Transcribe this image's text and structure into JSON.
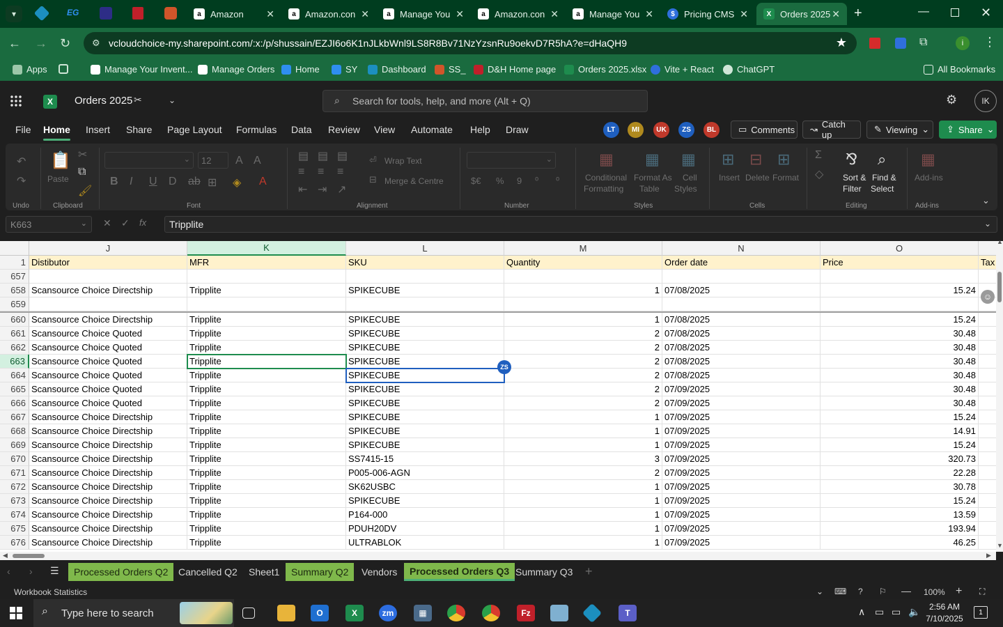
{
  "browser": {
    "tabs": [
      {
        "label": "Amazon",
        "icon": "amazon-icon"
      },
      {
        "label": "Amazon.con",
        "icon": "amazon-icon"
      },
      {
        "label": "Manage You",
        "icon": "amazon-icon"
      },
      {
        "label": "Amazon.con",
        "icon": "amazon-icon"
      },
      {
        "label": "Manage You",
        "icon": "amazon-icon"
      },
      {
        "label": "Pricing CMS",
        "icon": "dollar-icon"
      },
      {
        "label": "Orders 2025",
        "icon": "excel-icon"
      }
    ],
    "url": "vcloudchoice-my.sharepoint.com/:x:/p/shussain/EZJI6o6K1nJLkbWnl9LS8R8Bv71NzYzsnRu9oekvD7R5hA?e=dHaQH9",
    "bookmarks": [
      "Apps",
      "Manage Your Invent...",
      "Manage Orders",
      "Home",
      "SY",
      "Dashboard",
      "SS_",
      "D&H Home page",
      "Orders 2025.xlsx",
      "Vite + React",
      "ChatGPT"
    ],
    "all_bookmarks": "All Bookmarks"
  },
  "excel": {
    "title": "Orders 2025",
    "search_placeholder": "Search for tools, help, and more (Alt + Q)",
    "user_initials": "IK",
    "menu": [
      "File",
      "Home",
      "Insert",
      "Share",
      "Page Layout",
      "Formulas",
      "Data",
      "Review",
      "View",
      "Automate",
      "Help",
      "Draw"
    ],
    "active_menu": "Home",
    "collaborators": [
      {
        "initials": "LT",
        "color": "#1f5fbf"
      },
      {
        "initials": "MI",
        "color": "#b08a1e"
      },
      {
        "initials": "UK",
        "color": "#c0392b"
      },
      {
        "initials": "ZS",
        "color": "#1f5fbf"
      },
      {
        "initials": "BL",
        "color": "#c0392b"
      }
    ],
    "buttons": {
      "comments": "Comments",
      "catch_up": "Catch up",
      "viewing": "Viewing",
      "share": "Share"
    },
    "ribbon": {
      "undo_group": "Undo",
      "clipboard_group": "Clipboard",
      "paste": "Paste",
      "font_group": "Font",
      "font_size": "12",
      "alignment_group": "Alignment",
      "wrap_text": "Wrap Text",
      "merge_centre": "Merge & Centre",
      "number_group": "Number",
      "styles_group": "Styles",
      "conditional_1": "Conditional",
      "conditional_2": "Formatting",
      "format_as_1": "Format As",
      "format_as_2": "Table",
      "cell_styles_1": "Cell",
      "cell_styles_2": "Styles",
      "cells_group": "Cells",
      "insert": "Insert",
      "delete": "Delete",
      "format": "Format",
      "editing_group": "Editing",
      "sort_1": "Sort &",
      "sort_2": "Filter",
      "find_1": "Find &",
      "find_2": "Select",
      "addins_group": "Add-ins",
      "addins": "Add-ins"
    },
    "name_box": "K663",
    "formula_value": "Tripplite",
    "columns": [
      "J",
      "K",
      "L",
      "M",
      "N",
      "O"
    ],
    "header_row": {
      "row": "1",
      "cells": [
        "Distibutor",
        "MFR",
        "SKU",
        "Quantity",
        "Order date",
        "Price",
        "Tax"
      ]
    },
    "rows": [
      {
        "n": "657",
        "dist": "",
        "mfr": "",
        "sku": "",
        "qty": "",
        "date": "",
        "price": ""
      },
      {
        "n": "658",
        "dist": "Scansource Choice Directship",
        "mfr": "Tripplite",
        "sku": "SPIKECUBE",
        "qty": "1",
        "date": "07/08/2025",
        "price": "15.24"
      },
      {
        "n": "659",
        "dist": "",
        "mfr": "",
        "sku": "",
        "qty": "",
        "date": "",
        "price": ""
      },
      {
        "n": "660",
        "dist": "Scansource Choice Directship",
        "mfr": "Tripplite",
        "sku": "SPIKECUBE",
        "qty": "1",
        "date": "07/08/2025",
        "price": "15.24"
      },
      {
        "n": "661",
        "dist": "Scansource Choice Quoted",
        "mfr": "Tripplite",
        "sku": "SPIKECUBE",
        "qty": "2",
        "date": "07/08/2025",
        "price": "30.48"
      },
      {
        "n": "662",
        "dist": "Scansource Choice Quoted",
        "mfr": "Tripplite",
        "sku": "SPIKECUBE",
        "qty": "2",
        "date": "07/08/2025",
        "price": "30.48"
      },
      {
        "n": "663",
        "dist": "Scansource Choice Quoted",
        "mfr": "Tripplite",
        "sku": "SPIKECUBE",
        "qty": "2",
        "date": "07/08/2025",
        "price": "30.48"
      },
      {
        "n": "664",
        "dist": "Scansource Choice Quoted",
        "mfr": "Tripplite",
        "sku": "SPIKECUBE",
        "qty": "2",
        "date": "07/08/2025",
        "price": "30.48"
      },
      {
        "n": "665",
        "dist": "Scansource Choice Quoted",
        "mfr": "Tripplite",
        "sku": "SPIKECUBE",
        "qty": "2",
        "date": "07/09/2025",
        "price": "30.48"
      },
      {
        "n": "666",
        "dist": "Scansource Choice Quoted",
        "mfr": "Tripplite",
        "sku": "SPIKECUBE",
        "qty": "2",
        "date": "07/09/2025",
        "price": "30.48"
      },
      {
        "n": "667",
        "dist": "Scansource Choice Directship",
        "mfr": "Tripplite",
        "sku": "SPIKECUBE",
        "qty": "1",
        "date": "07/09/2025",
        "price": "15.24"
      },
      {
        "n": "668",
        "dist": "Scansource Choice Directship",
        "mfr": "Tripplite",
        "sku": "SPIKECUBE",
        "qty": "1",
        "date": "07/09/2025",
        "price": "14.91"
      },
      {
        "n": "669",
        "dist": "Scansource Choice Directship",
        "mfr": "Tripplite",
        "sku": "SPIKECUBE",
        "qty": "1",
        "date": "07/09/2025",
        "price": "15.24"
      },
      {
        "n": "670",
        "dist": "Scansource Choice Directship",
        "mfr": "Tripplite",
        "sku": "SS7415-15",
        "qty": "3",
        "date": "07/09/2025",
        "price": "320.73"
      },
      {
        "n": "671",
        "dist": "Scansource Choice Directship",
        "mfr": "Tripplite",
        "sku": "P005-006-AGN",
        "qty": "2",
        "date": "07/09/2025",
        "price": "22.28"
      },
      {
        "n": "672",
        "dist": "Scansource Choice Directship",
        "mfr": "Tripplite",
        "sku": "SK62USBC",
        "qty": "1",
        "date": "07/09/2025",
        "price": "30.78"
      },
      {
        "n": "673",
        "dist": "Scansource Choice Directship",
        "mfr": "Tripplite",
        "sku": "SPIKECUBE",
        "qty": "1",
        "date": "07/09/2025",
        "price": "15.24"
      },
      {
        "n": "674",
        "dist": "Scansource Choice Directship",
        "mfr": "Tripplite",
        "sku": "P164-000",
        "qty": "1",
        "date": "07/09/2025",
        "price": "13.59"
      },
      {
        "n": "675",
        "dist": "Scansource Choice Directship",
        "mfr": "Tripplite",
        "sku": "PDUH20DV",
        "qty": "1",
        "date": "07/09/2025",
        "price": "193.94"
      },
      {
        "n": "676",
        "dist": "Scansource Choice Directship",
        "mfr": "Tripplite",
        "sku": "ULTRABLOK",
        "qty": "1",
        "date": "07/09/2025",
        "price": "46.25"
      }
    ],
    "collab_flag": "ZS",
    "sheets": [
      {
        "label": "Processed Orders Q2",
        "green": true
      },
      {
        "label": "Cancelled Q2",
        "green": false
      },
      {
        "label": "Sheet1",
        "green": false
      },
      {
        "label": "Summary Q2",
        "green": true
      },
      {
        "label": "Vendors",
        "green": false
      },
      {
        "label": "Processed Orders Q3",
        "green": true,
        "active": true
      },
      {
        "label": "Summary Q3",
        "green": false
      }
    ],
    "status": {
      "left": "Workbook Statistics",
      "zoom": "100%"
    }
  },
  "taskbar": {
    "search_placeholder": "Type here to search",
    "time": "2:56 AM",
    "date": "7/10/2025",
    "notification_count": "1"
  }
}
